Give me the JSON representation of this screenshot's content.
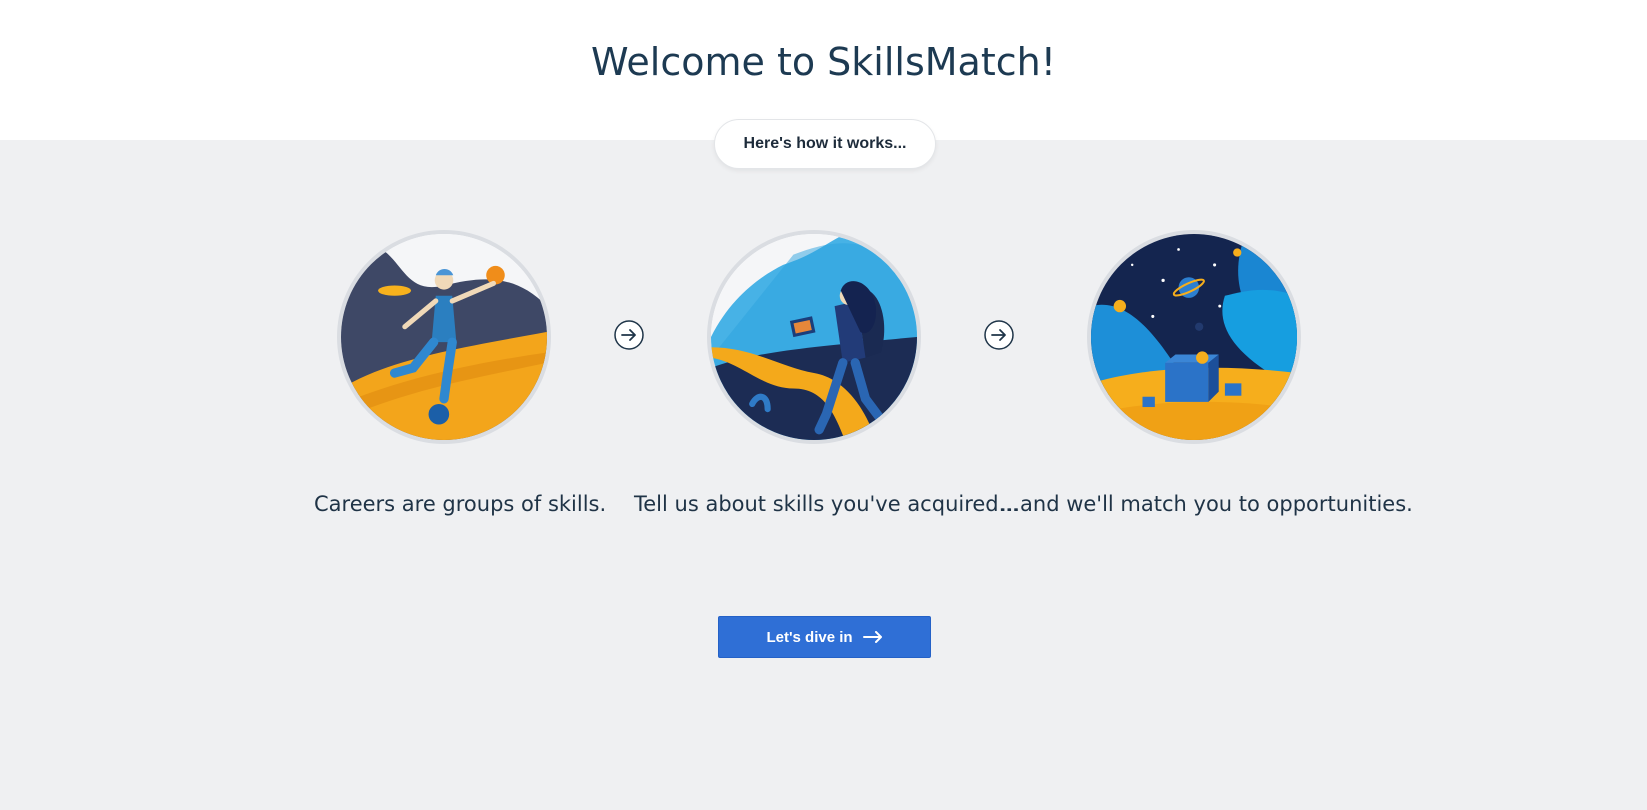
{
  "header": {
    "title": "Welcome to SkillsMatch!",
    "subtitle_pill": "Here's how it works..."
  },
  "steps": [
    {
      "caption": "Careers are groups of skills.",
      "icon": "juggler-illustration"
    },
    {
      "caption": "Tell us about skills you've acquired...",
      "icon": "walker-illustration"
    },
    {
      "caption": "...and we'll match you to opportunities.",
      "icon": "space-boxes-illustration"
    }
  ],
  "step_arrows": [
    "arrow-right-circle-icon",
    "arrow-right-circle-icon"
  ],
  "cta": {
    "label": "Let's dive in",
    "icon": "arrow-right-icon"
  },
  "colors": {
    "background": "#eff0f2",
    "header_bg": "#ffffff",
    "heading": "#1d3a52",
    "cta_button": "#2f6fd6",
    "accent_yellow": "#f7ab1a",
    "accent_blue": "#1e9ad9",
    "navy": "#1b2a4e"
  }
}
